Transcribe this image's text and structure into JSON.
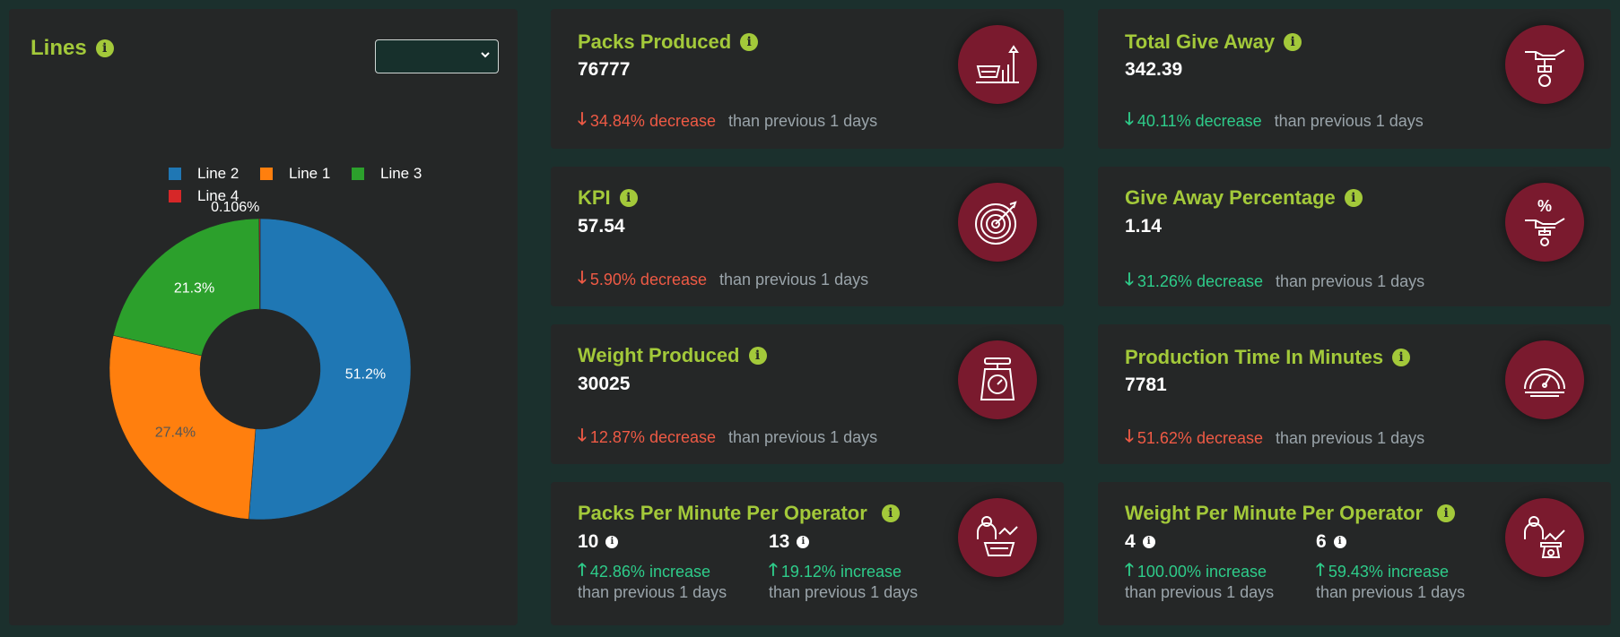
{
  "lines_panel": {
    "title": "Lines",
    "select_value": "",
    "legend": [
      {
        "name": "Line 2",
        "color": "#1f77b4"
      },
      {
        "name": "Line 1",
        "color": "#ff7f0e"
      },
      {
        "name": "Line 3",
        "color": "#2ca02c"
      },
      {
        "name": "Line 4",
        "color": "#d62728"
      }
    ]
  },
  "chart_data": {
    "type": "pie",
    "hole": true,
    "labels": [
      "Line 2",
      "Line 1",
      "Line 3",
      "Line 4"
    ],
    "values": [
      51.2,
      27.4,
      21.3,
      0.106
    ],
    "value_labels": [
      "51.2%",
      "27.4%",
      "21.3%",
      "0.106%"
    ],
    "colors": [
      "#1f77b4",
      "#ff7f0e",
      "#2ca02c",
      "#d62728"
    ],
    "legend_placement": "top"
  },
  "cards": {
    "packs_produced": {
      "title": "Packs Produced",
      "value": "76777",
      "change": "34.84% decrease",
      "comparison": "than previous 1 days",
      "icon": "packs-chart-icon"
    },
    "kpi": {
      "title": "KPI",
      "value": "57.54",
      "change": "5.90% decrease",
      "comparison": "than previous 1 days",
      "icon": "target-icon"
    },
    "weight_produced": {
      "title": "Weight Produced",
      "value": "30025",
      "change": "12.87% decrease",
      "comparison": "than previous 1 days",
      "icon": "scale-icon"
    },
    "packs_per_minute": {
      "title": "Packs Per Minute Per Operator",
      "icon": "operator-basket-icon",
      "a": {
        "value": "10",
        "change": "42.86% increase",
        "comparison": "than previous 1 days"
      },
      "b": {
        "value": "13",
        "change": "19.12% increase",
        "comparison": "than previous 1 days"
      }
    },
    "total_give_away": {
      "title": "Total Give Away",
      "value": "342.39",
      "change": "40.11% decrease",
      "comparison": "than previous 1 days",
      "icon": "hand-giving-icon"
    },
    "give_away_percentage": {
      "title": "Give Away Percentage",
      "value": "1.14",
      "change": "31.26% decrease",
      "comparison": "than previous 1 days",
      "icon": "percent-hand-icon",
      "icon_glyph": "%"
    },
    "production_time": {
      "title": "Production Time In Minutes",
      "value": "7781",
      "change": "51.62% decrease",
      "comparison": "than previous 1 days",
      "icon": "speedometer-icon"
    },
    "weight_per_minute": {
      "title": "Weight Per Minute Per Operator",
      "icon": "operator-scale-icon",
      "a": {
        "value": "4",
        "change": "100.00% increase",
        "comparison": "than previous 1 days"
      },
      "b": {
        "value": "6",
        "change": "59.43% increase",
        "comparison": "than previous 1 days"
      }
    }
  },
  "glyphs": {
    "info": "i",
    "arrow_down": "🡓",
    "arrow_up": "🡑"
  }
}
